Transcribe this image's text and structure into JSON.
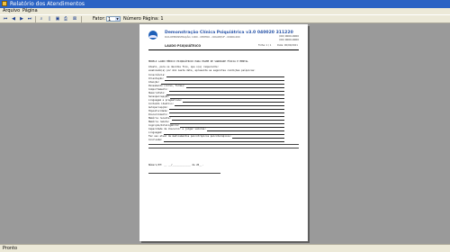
{
  "window": {
    "title": "Relatório dos Atendimentos"
  },
  "menu": {
    "items": [
      "Arquivo",
      "Página"
    ]
  },
  "toolbar": {
    "zoom_label": "Fator:",
    "zoom_value": "1",
    "page_label": "Número Página: 1"
  },
  "document": {
    "clinic_name": "Demonstração Clínica Psiquiátrica v3.0 040020 311220",
    "clinic_address": "RUA DEMONSTRAÇÃO, 1000 - CENTRO - CIDADE/UF - 00000-000",
    "phones": [
      "(00) 0000-0000",
      "(00) 0000-0000"
    ],
    "doc_title": "LAUDO PSIQUIÁTRICO",
    "folio": "Folha: 1 / 1",
    "date": "Data: 00/00/2021",
    "heading": "MODELO LAUDO MÉDICO PSIQUIÁTRICO PARA EXAME DE SANIDADE FÍSICA E MENTAL",
    "intro_line1": "Atesto, para os devidos fins, que o(a) requerente:",
    "intro_line2": "examinado(a) por mim nesta data, apresenta as seguintes condições psíquicas:",
    "fields": [
      "Consciência:",
      "Orientação:",
      "Atenção:",
      "Pensamento (curso, forma):",
      "Comportamento:",
      "Humor/Afeto:",
      "Sensopercepção:",
      "Linguagem e pragmatismo:",
      "Conteúdo ideativo:",
      "Autopercepção:",
      "Hipoatividade:",
      "Discernimento:",
      "Memória recente:",
      "Memória remota:",
      "Cognição/Inteligência:",
      "Capacidade de discernir e julgar valores:",
      "Linguagem:",
      "Faz uso atual de medicamentos psicotrópicos psicoterápicos:",
      "Conclusão:"
    ],
    "signature_line": "Número/DT: __ __/_____________ de 20__."
  },
  "statusbar": {
    "text": "Pronto"
  }
}
